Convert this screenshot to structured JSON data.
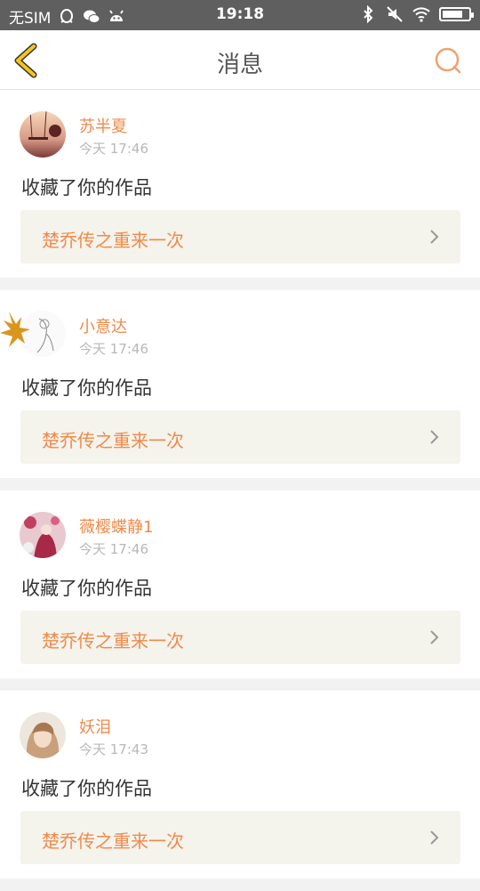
{
  "status_bar": {
    "carrier": "无SIM",
    "time": "19:18",
    "icons": [
      "qq-icon",
      "wechat-icon",
      "android-icon",
      "bluetooth-icon",
      "mute-icon",
      "wifi-icon",
      "battery-icon"
    ]
  },
  "header": {
    "title": "消息",
    "accent_color": "#f5c518",
    "search_color": "#f0a070"
  },
  "messages": [
    {
      "username": "苏半夏",
      "time": "今天 17:46",
      "action": "收藏了你的作品",
      "work_title": "楚乔传之重来一次",
      "avatar": "sunset-swing-avatar"
    },
    {
      "username": "小意达",
      "time": "今天 17:46",
      "action": "收藏了你的作品",
      "work_title": "楚乔传之重来一次",
      "avatar": "maple-leaf-sketch-avatar"
    },
    {
      "username": "薇樱蝶静1",
      "time": "今天 17:46",
      "action": "收藏了你的作品",
      "work_title": "楚乔传之重来一次",
      "avatar": "flower-girl-avatar"
    },
    {
      "username": "妖泪",
      "time": "今天 17:43",
      "action": "收藏了你的作品",
      "work_title": "楚乔传之重来一次",
      "avatar": "portrait-avatar"
    }
  ]
}
